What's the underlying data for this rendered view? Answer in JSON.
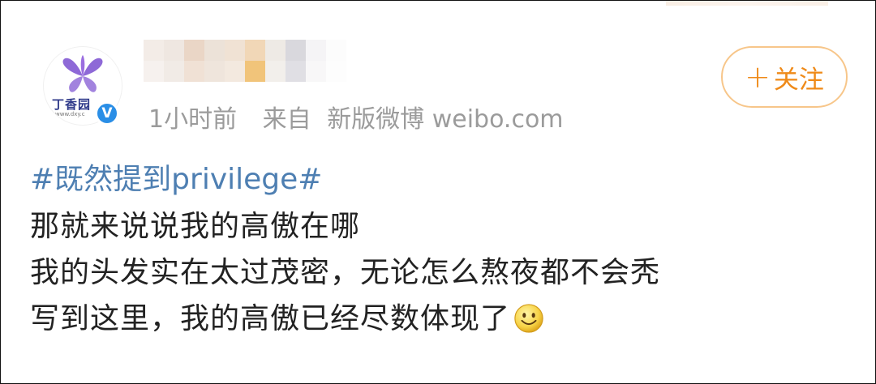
{
  "post": {
    "avatar": {
      "brand_text": "丁香园",
      "url_text": "www.dxy.c",
      "verified_mark": "V",
      "icon": "butterfly-logo-icon",
      "brand_color": "#2f3a8a",
      "logo_color": "#7a4fd0"
    },
    "meta": {
      "time": "1小时前",
      "source_prefix": "来自",
      "source_name": "新版微博 weibo.com"
    },
    "follow_button": {
      "plus": "+",
      "label": "关注"
    },
    "content": {
      "hashtag": "#既然提到privilege#",
      "lines": [
        "那就来说说我的高傲在哪",
        "我的头发实在太过茂密，无论怎么熬夜都不会秃",
        "写到这里，我的高傲已经尽数体现了"
      ],
      "trailing_emoji": "smile-emoji-icon"
    }
  },
  "colors": {
    "hashtag": "#4e7fb2",
    "meta_text": "#9b9b9b",
    "follow_text": "#ef8a18",
    "follow_border": "#f7c68a",
    "body_text": "#222222",
    "verify_badge": "#2a8ee6"
  }
}
